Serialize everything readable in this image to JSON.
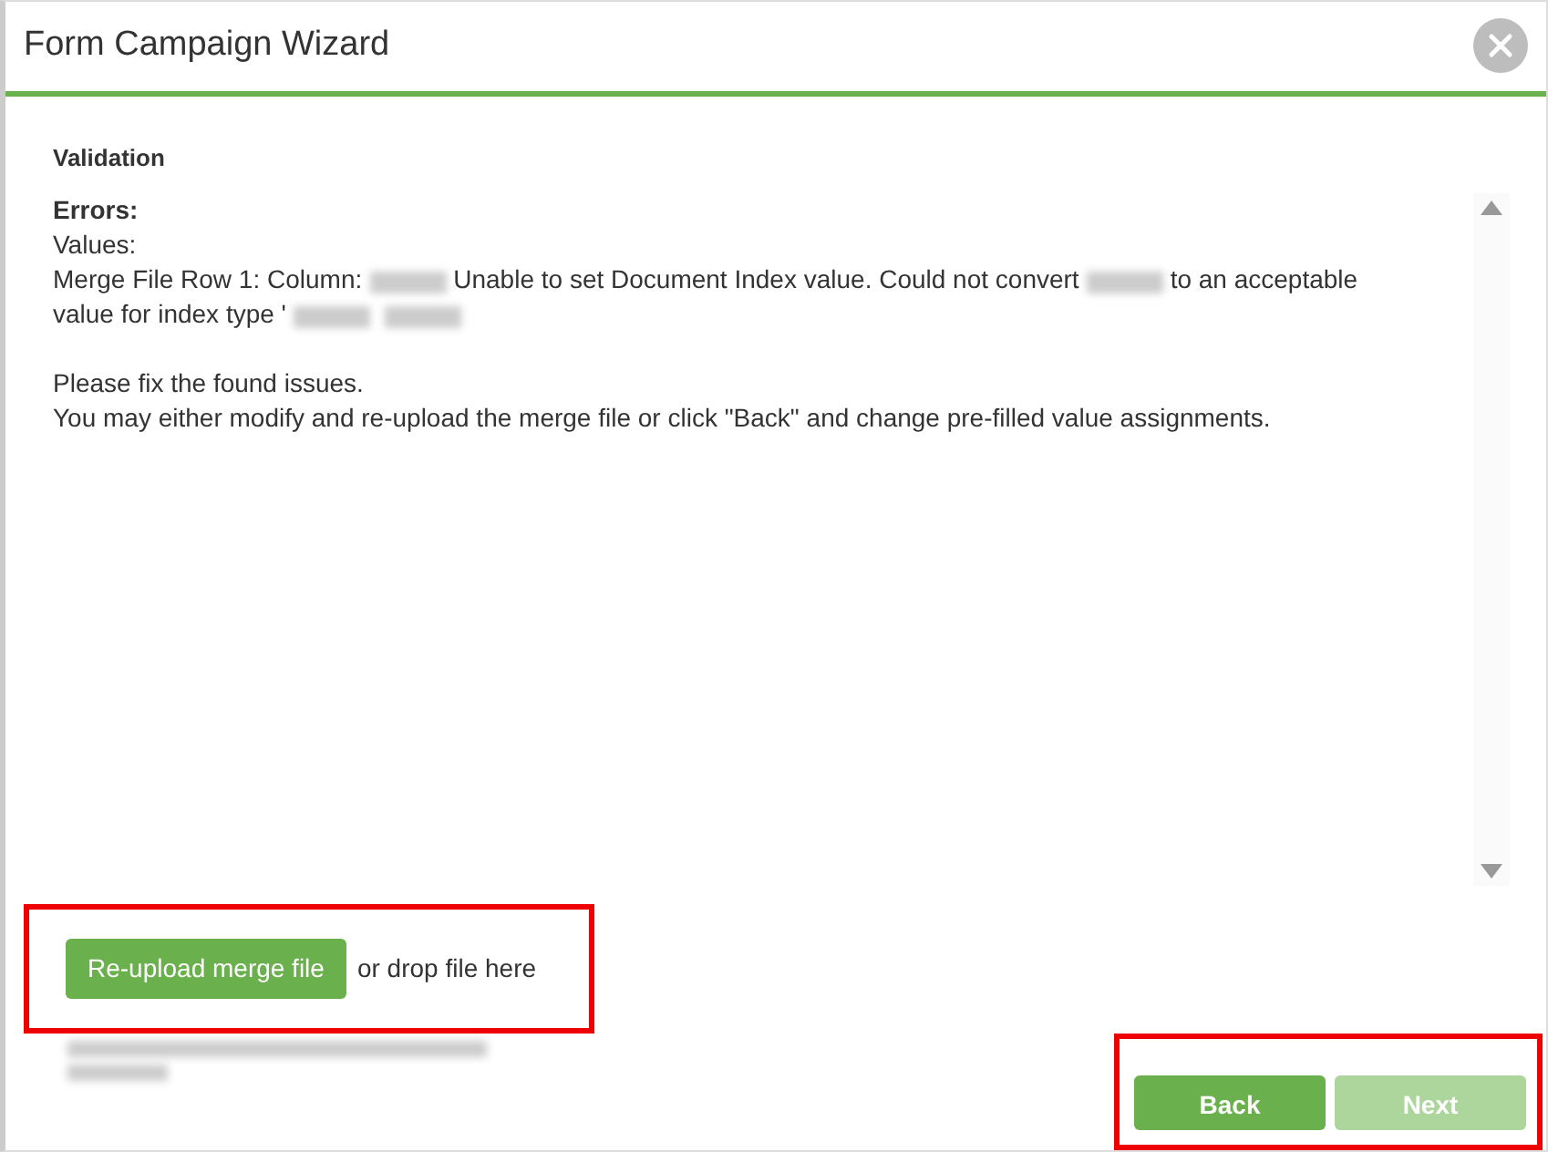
{
  "window": {
    "title": "Form Campaign Wizard"
  },
  "section": {
    "title": "Validation"
  },
  "message": {
    "heading": "Errors:",
    "paragraphs": [
      {
        "lines": [
          {
            "parts": [
              {
                "kind": "text",
                "text": "Values:"
              }
            ]
          },
          {
            "parts": [
              {
                "kind": "text",
                "text": "Merge File Row 1: Column:"
              },
              {
                "kind": "redacted"
              },
              {
                "kind": "text",
                "text": "Unable to set Document Index value. Could not convert"
              },
              {
                "kind": "redacted"
              },
              {
                "kind": "text",
                "text": "to an acceptable"
              }
            ]
          },
          {
            "parts": [
              {
                "kind": "text",
                "text": "value for index type '"
              },
              {
                "kind": "redacted"
              },
              {
                "kind": "redacted"
              }
            ]
          }
        ]
      },
      {
        "lines": [
          {
            "parts": [
              {
                "kind": "text",
                "text": "Please fix the found issues."
              }
            ]
          },
          {
            "parts": [
              {
                "kind": "text",
                "text": "You may either modify and re-upload the merge file or click \"Back\" and change pre-filled value assignments."
              }
            ]
          }
        ]
      }
    ]
  },
  "upload": {
    "button": "Re-upload merge file",
    "hint": "or drop file here",
    "highlighted": true
  },
  "footer": {
    "highlighted": true,
    "buttons": [
      {
        "label": "Back",
        "disabled": false
      },
      {
        "label": "Next",
        "disabled": true
      }
    ]
  }
}
